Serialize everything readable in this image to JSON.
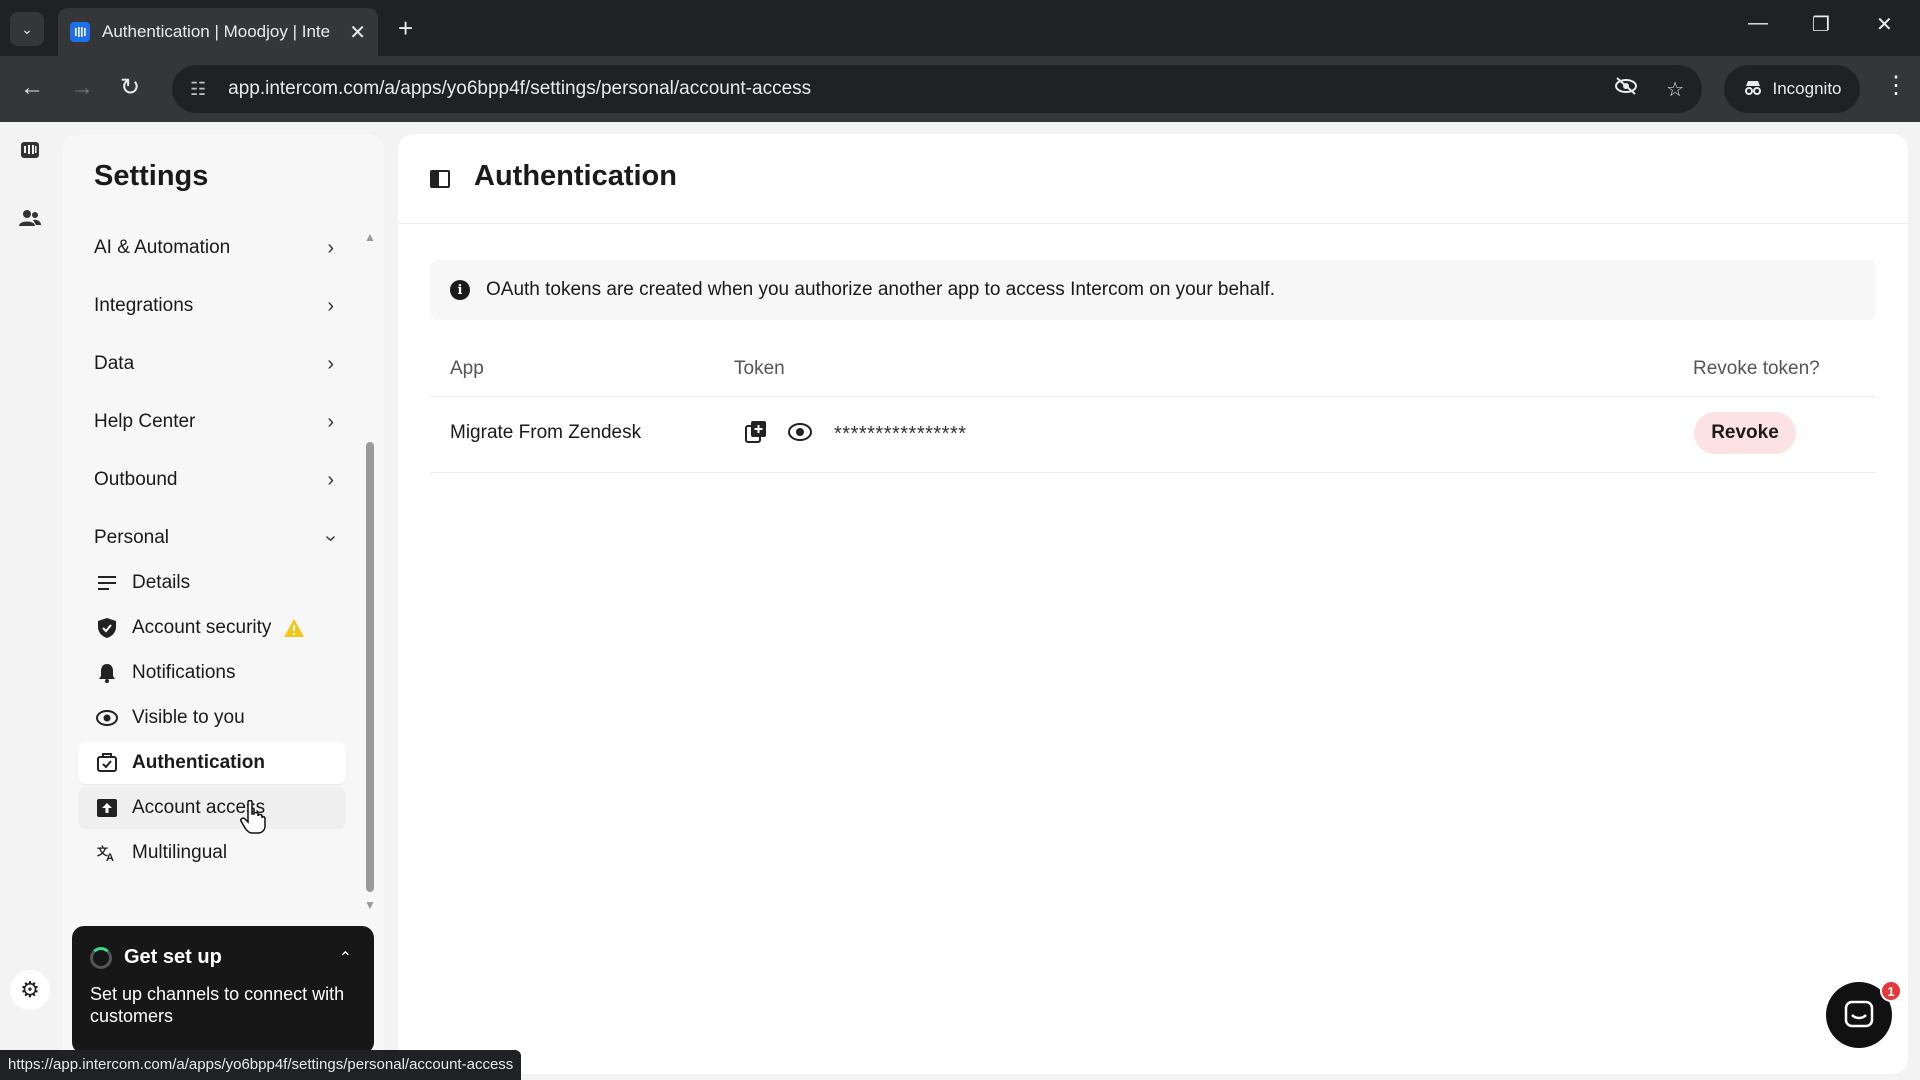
{
  "browser": {
    "tab_title": "Authentication | Moodjoy | Inte",
    "url": "app.intercom.com/a/apps/yo6bpp4f/settings/personal/account-access",
    "incognito_label": "Incognito",
    "status_url": "https://app.intercom.com/a/apps/yo6bpp4f/settings/personal/account-access"
  },
  "sidebar": {
    "title": "Settings",
    "groups": [
      {
        "label": "AI & Automation"
      },
      {
        "label": "Integrations"
      },
      {
        "label": "Data"
      },
      {
        "label": "Help Center"
      },
      {
        "label": "Outbound"
      },
      {
        "label": "Personal"
      }
    ],
    "items": [
      {
        "label": "Details",
        "icon": "list-icon"
      },
      {
        "label": "Account security",
        "icon": "shield-check-icon"
      },
      {
        "label": "Notifications",
        "icon": "bell-icon"
      },
      {
        "label": "Visible to you",
        "icon": "eye-icon"
      },
      {
        "label": "Authentication",
        "icon": "auth-icon"
      },
      {
        "label": "Account access",
        "icon": "account-access-icon"
      },
      {
        "label": "Multilingual",
        "icon": "translate-icon"
      }
    ],
    "get_set_up": {
      "title": "Get set up",
      "text": "Set up channels to connect with customers"
    }
  },
  "main": {
    "title": "Authentication",
    "info": "OAuth tokens are created when you authorize another app to access Intercom on your behalf.",
    "table": {
      "headers": {
        "app": "App",
        "token": "Token",
        "revoke": "Revoke token?"
      },
      "rows": [
        {
          "app": "Migrate From Zendesk",
          "token": "****************",
          "action": "Revoke"
        }
      ]
    }
  },
  "messenger": {
    "badge": "1"
  },
  "colors": {
    "revoke_bg": "#fde2e4",
    "warning": "#f5c518",
    "badge": "#e5383b"
  }
}
